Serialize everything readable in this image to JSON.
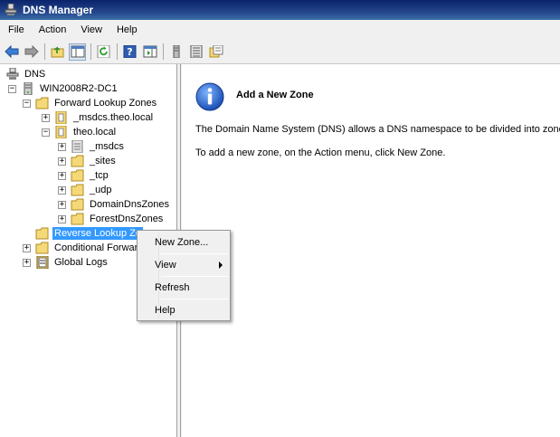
{
  "window": {
    "title": "DNS Manager"
  },
  "menubar": {
    "items": [
      "File",
      "Action",
      "View",
      "Help"
    ]
  },
  "toolbar": {
    "buttons": [
      "back-icon",
      "forward-icon",
      "up-folder-icon",
      "show-hide-tree-icon",
      "refresh-icon",
      "help-icon",
      "show-action-pane-icon",
      "server-icon",
      "list-icon",
      "properties-icon"
    ]
  },
  "tree": {
    "root": "DNS",
    "server": "WIN2008R2-DC1",
    "forward_zones": "Forward Lookup Zones",
    "msdcs_zone": "_msdcs.theo.local",
    "theo_local": "theo.local",
    "msdcs": "_msdcs",
    "sites": "_sites",
    "tcp": "_tcp",
    "udp": "_udp",
    "domain_dns": "DomainDnsZones",
    "forest_dns": "ForestDnsZones",
    "reverse_zones": "Reverse Lookup Zo",
    "conditional": "Conditional Forwar",
    "global_logs": "Global Logs"
  },
  "content": {
    "heading": "Add a New Zone",
    "para1": "The Domain Name System (DNS) allows a DNS namespace to be divided into zones. E",
    "para2": "To add a new zone, on the Action menu, click New Zone."
  },
  "context_menu": {
    "new_zone": "New Zone...",
    "view": "View",
    "refresh": "Refresh",
    "help": "Help"
  },
  "colors": {
    "title_bar": "#0a246a",
    "selection": "#3399ff",
    "folder": "#f5d979"
  }
}
